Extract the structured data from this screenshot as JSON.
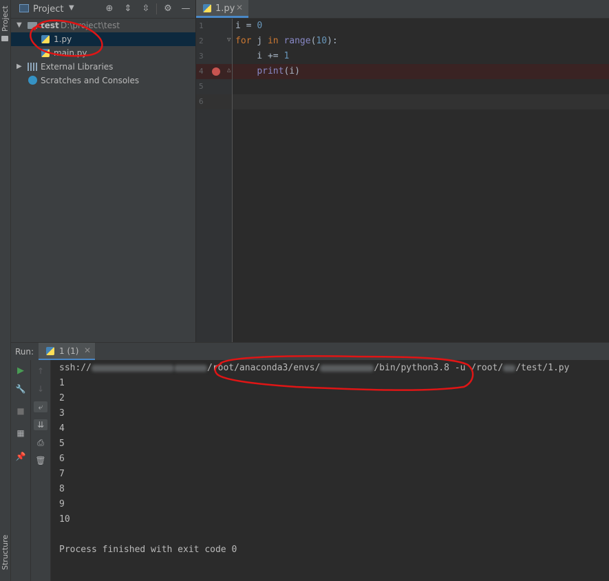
{
  "left_strip": {
    "project_label": "Project",
    "structure_label": "Structure"
  },
  "project_panel": {
    "title": "Project",
    "tree": {
      "root_name": "test",
      "root_path": "D:\\project\\test",
      "files": [
        {
          "name": "1.py"
        },
        {
          "name": "main.py"
        }
      ],
      "external_libraries": "External Libraries",
      "scratches": "Scratches and Consoles"
    }
  },
  "editor": {
    "tab_label": "1.py",
    "line_numbers": [
      "1",
      "2",
      "3",
      "4",
      "5",
      "6"
    ],
    "code": {
      "l1_var": "i",
      "l1_eq": " = ",
      "l1_num": "0",
      "l2_for": "for",
      "l2_mid": " j ",
      "l2_in": "in",
      "l2_range": " range",
      "l2_open": "(",
      "l2_num": "10",
      "l2_close": "):",
      "l3_text": "    i += ",
      "l3_num": "1",
      "l4_indent": "    ",
      "l4_print": "print",
      "l4_args": "(i)"
    },
    "breakpoint_line": 4,
    "accent": "#4a88c7",
    "breakpoint_color": "#c75450"
  },
  "run_panel": {
    "label": "Run:",
    "tab_label": "1 (1)",
    "command": {
      "prefix": "ssh://",
      "part2": "/root/anaconda3/envs/",
      "part3": "/bin/python3.8 -u /root/",
      "part4": "/test/1.py"
    },
    "output": [
      "1",
      "2",
      "3",
      "4",
      "5",
      "6",
      "7",
      "8",
      "9",
      "10"
    ],
    "exit_message": "Process finished with exit code 0"
  },
  "annotations": {
    "circle_color": "#e01515"
  }
}
